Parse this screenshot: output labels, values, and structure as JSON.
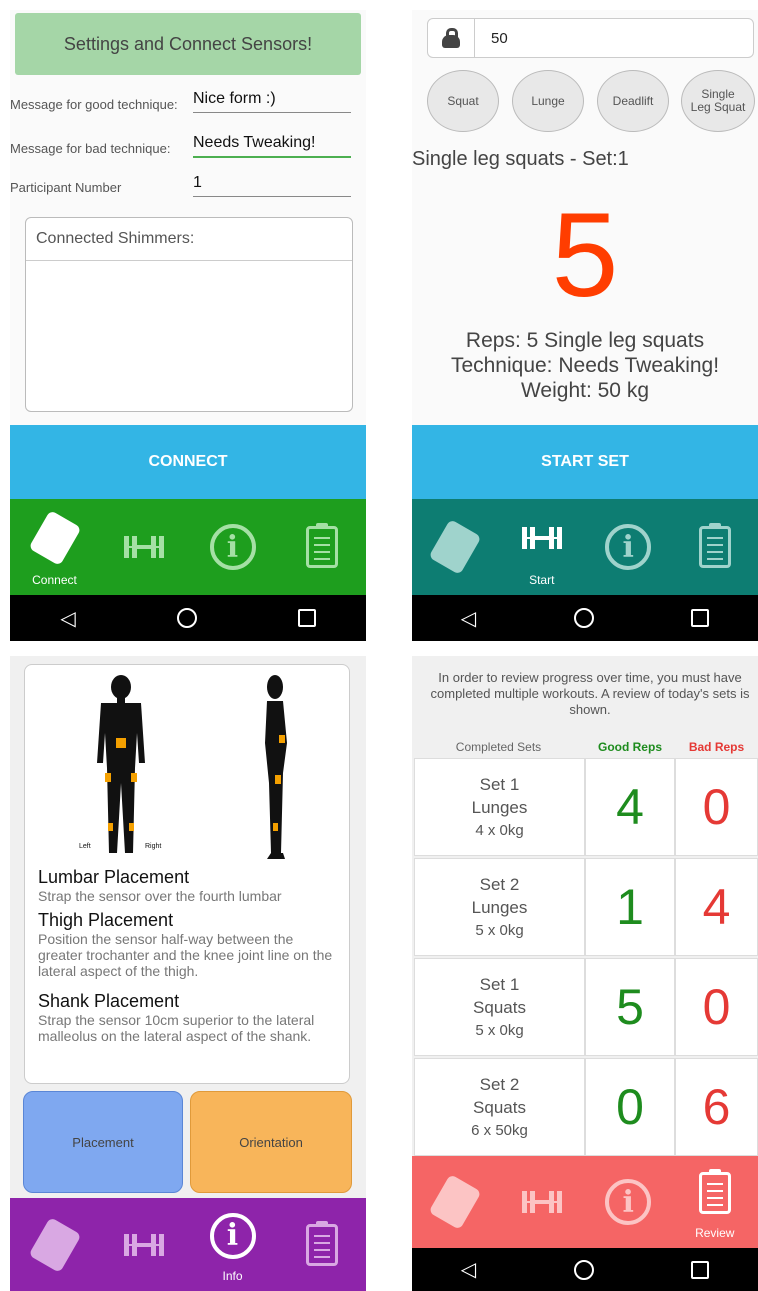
{
  "colors": {
    "connect_blue": "#33b5e5",
    "nav_green": "#1e9e1e",
    "nav_teal": "#0d7d72",
    "nav_purple": "#8e24aa",
    "nav_red": "#f56565",
    "header_green": "#a5d6a7",
    "big_number_red": "#ff3d00",
    "good_green": "#1e8c1e",
    "bad_red": "#e53935",
    "placement_blue": "#7fa8f0",
    "orientation_orange": "#f8b55a"
  },
  "connect_screen": {
    "header": "Settings and Connect Sensors!",
    "good_label": "Message for good technique:",
    "good_value": "Nice form :)",
    "bad_label": "Message for bad technique:",
    "bad_value": "Needs Tweaking!",
    "participant_label": "Participant Number",
    "participant_value": "1",
    "shimmers_title": "Connected Shimmers:",
    "connect_button": "CONNECT",
    "nav_active_label": "Connect"
  },
  "start_screen": {
    "weight_value": "50",
    "exercises": [
      "Squat",
      "Lunge",
      "Deadlift",
      "Single Leg Squat"
    ],
    "set_title": "Single leg squats - Set:1",
    "rep_count": "5",
    "summary_reps": "Reps: 5 Single leg squats",
    "summary_technique": "Technique: Needs Tweaking!",
    "summary_weight": "Weight: 50 kg",
    "start_button": "START SET",
    "nav_active_label": "Start"
  },
  "info_screen": {
    "body_left": "Left",
    "body_right": "Right",
    "sections": [
      {
        "title": "Lumbar Placement",
        "text": "Strap the sensor over the fourth lumbar"
      },
      {
        "title": "Thigh Placement",
        "text": "Position the sensor half-way between the greater trochanter and the knee joint line on the lateral aspect of the thigh."
      },
      {
        "title": "Shank Placement",
        "text": "Strap the sensor 10cm superior to the lateral malleolus on the lateral aspect of the shank."
      }
    ],
    "placement_button": "Placement",
    "orientation_button": "Orientation",
    "nav_active_label": "Info"
  },
  "review_screen": {
    "notice": "In order to review progress over time, you must have completed multiple workouts. A review of today's sets is shown.",
    "col_sets": "Completed Sets",
    "col_good": "Good Reps",
    "col_bad": "Bad Reps",
    "rows": [
      {
        "set": "Set 1",
        "exercise": "Lunges",
        "load": "4 x 0kg",
        "good": "4",
        "bad": "0"
      },
      {
        "set": "Set 2",
        "exercise": "Lunges",
        "load": "5 x 0kg",
        "good": "1",
        "bad": "4"
      },
      {
        "set": "Set 1",
        "exercise": "Squats",
        "load": "5 x 0kg",
        "good": "5",
        "bad": "0"
      },
      {
        "set": "Set 2",
        "exercise": "Squats",
        "load": "6 x 50kg",
        "good": "0",
        "bad": "6"
      }
    ],
    "nav_active_label": "Review"
  },
  "icons": {
    "nav": [
      "sensor-card-icon",
      "dumbbell-icon",
      "info-icon",
      "clipboard-icon"
    ],
    "weight": "kettlebell-icon",
    "system": [
      "back-icon",
      "home-icon",
      "recents-icon"
    ]
  }
}
